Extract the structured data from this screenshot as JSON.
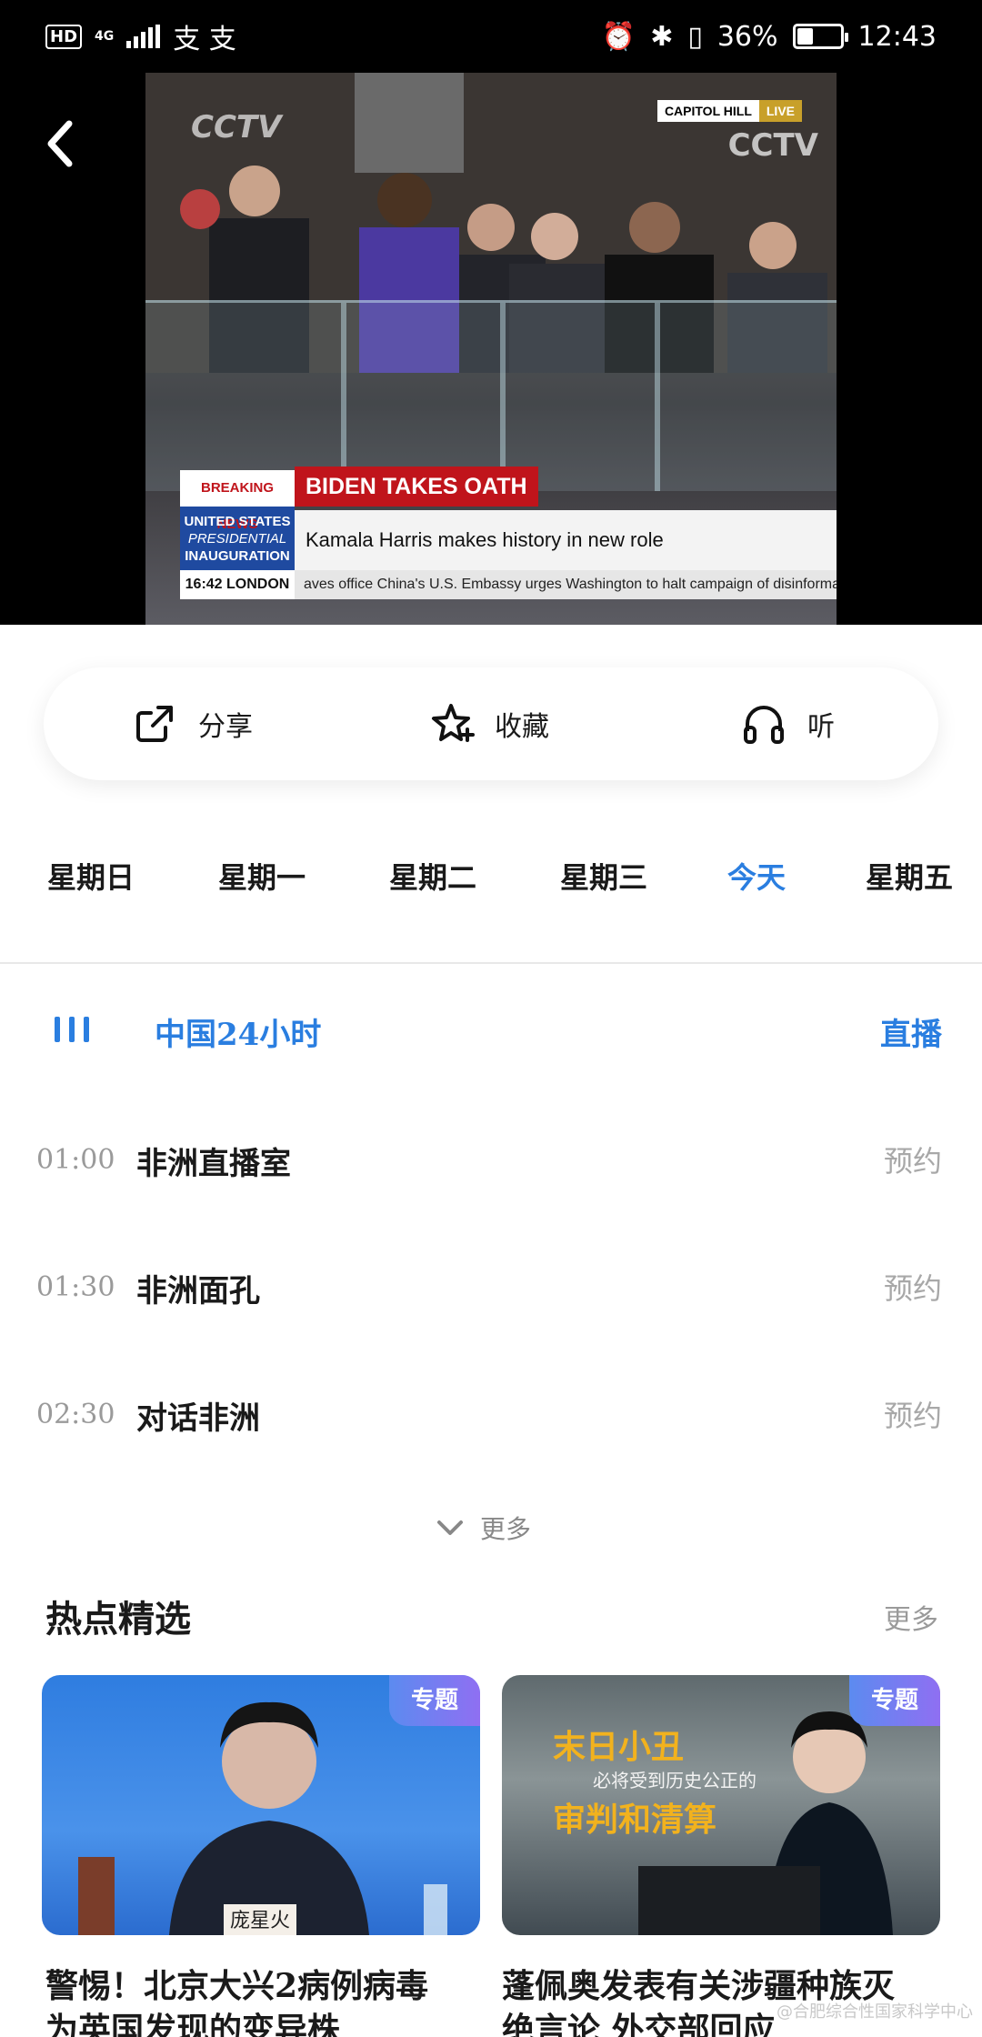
{
  "status_bar": {
    "network": "4G",
    "hd": "HD",
    "carrier_icons": "支 支",
    "battery": "36%",
    "battery_level": 0.36,
    "time": "12:43"
  },
  "video": {
    "capitol_tag": "CAPITOL HILL",
    "live_tag": "LIVE",
    "logo": "CCTV",
    "breaking": "BREAKING NEWS",
    "event_line1": "UNITED STATES",
    "event_line2": "PRESIDENTIAL",
    "event_line3": "INAUGURATION",
    "headline": "BIDEN TAKES OATH",
    "subline": "Kamala Harris makes history in new role",
    "ticker_time": "16:42 LONDON",
    "ticker_text": "aves office        China's U.S. Embassy urges Washington to halt campaign of disinformation on"
  },
  "actions": {
    "share": "分享",
    "favorite": "收藏",
    "listen": "听"
  },
  "days": [
    "星期日",
    "星期一",
    "星期二",
    "星期三",
    "今天",
    "星期五"
  ],
  "active_day": "今天",
  "schedule": {
    "channel": "中国24小时",
    "live_label": "直播",
    "programs": [
      {
        "time": "01:00",
        "name": "非洲直播室",
        "action": "预约"
      },
      {
        "time": "01:30",
        "name": "非洲面孔",
        "action": "预约"
      },
      {
        "time": "02:30",
        "name": "对话非洲",
        "action": "预约"
      }
    ],
    "more": "更多"
  },
  "hot": {
    "title": "热点精选",
    "more": "更多",
    "cards": [
      {
        "tag": "专题",
        "caption_line1": "警惕！北京大兴2病例病毒",
        "caption_line2": "为英国发现的变异株",
        "image_text": "庞星火"
      },
      {
        "tag": "专题",
        "caption_line1": "蓬佩奥发表有关涉疆种族灭",
        "caption_line2": "绝言论 外交部回应",
        "image_text1": "末日小丑",
        "image_text2": "必将受到历史公正的",
        "image_text3": "审判和清算"
      }
    ],
    "watermark": "@合肥综合性国家科学中心"
  },
  "colors": {
    "accent": "#2a7ee0",
    "tag_start": "#5c8bf0",
    "tag_end": "#8f6ff2"
  }
}
